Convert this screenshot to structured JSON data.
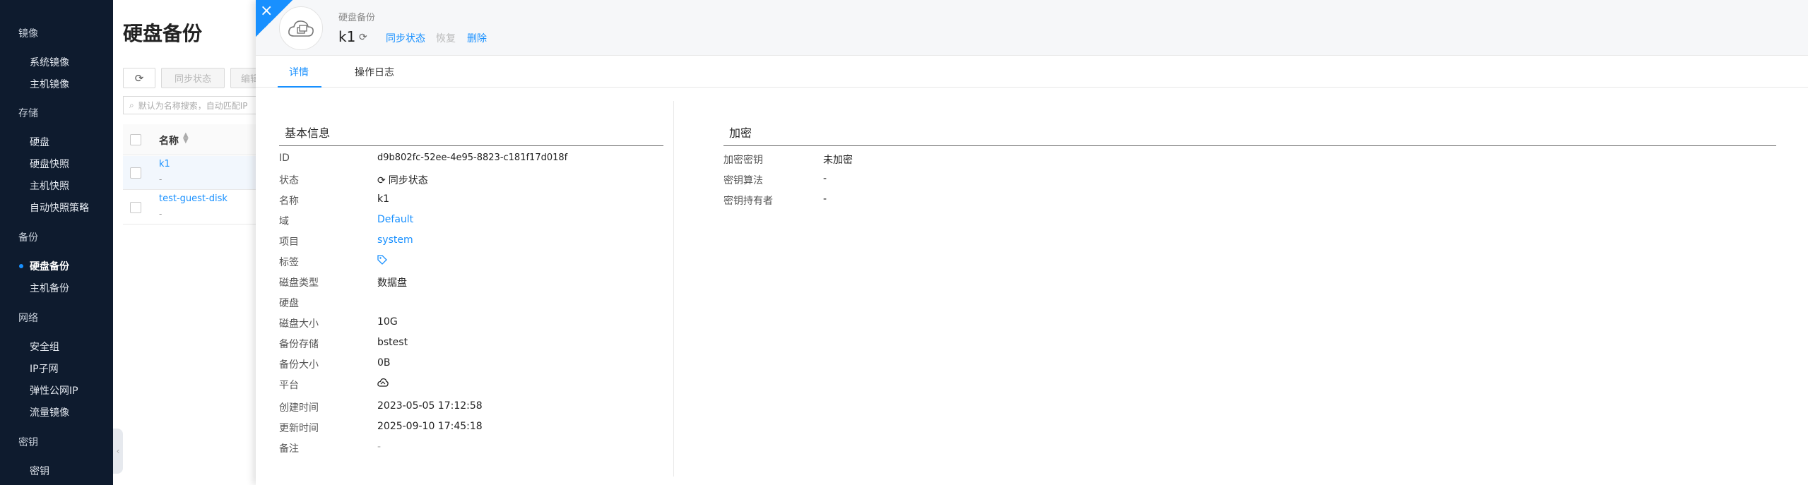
{
  "sidebar": {
    "groups": [
      {
        "label": "镜像",
        "items": [
          {
            "label": "系统镜像"
          },
          {
            "label": "主机镜像"
          }
        ]
      },
      {
        "label": "存储",
        "items": [
          {
            "label": "硬盘"
          },
          {
            "label": "硬盘快照"
          },
          {
            "label": "主机快照"
          },
          {
            "label": "自动快照策略"
          }
        ]
      },
      {
        "label": "备份",
        "items": [
          {
            "label": "硬盘备份",
            "active": true
          },
          {
            "label": "主机备份"
          }
        ]
      },
      {
        "label": "网络",
        "items": [
          {
            "label": "安全组"
          },
          {
            "label": "IP子网"
          },
          {
            "label": "弹性公网IP"
          },
          {
            "label": "流量镜像"
          }
        ]
      },
      {
        "label": "密钥",
        "items": [
          {
            "label": "密钥"
          }
        ]
      }
    ]
  },
  "list_page": {
    "title": "硬盘备份",
    "toolbar": {
      "sync_label": "同步状态",
      "edit_label": "编辑"
    },
    "search_placeholder": "默认为名称搜索，自动匹配IP",
    "columns": {
      "name": "名称"
    },
    "rows": [
      {
        "name": "k1",
        "sub": "-"
      },
      {
        "name": "test-guest-disk",
        "sub": "-"
      }
    ]
  },
  "drawer": {
    "close_label": "×",
    "resource_type": "硬盘备份",
    "resource_name": "k1",
    "actions": {
      "sync": "同步状态",
      "restore": "恢复",
      "delete": "删除"
    },
    "tabs": {
      "detail": "详情",
      "log": "操作日志"
    },
    "basic": {
      "title": "基本信息",
      "fields": {
        "id_label": "ID",
        "id": "d9b802fc-52ee-4e95-8823-c181f17d018f",
        "status_label": "状态",
        "status": "同步状态",
        "name_label": "名称",
        "name": "k1",
        "domain_label": "域",
        "domain": "Default",
        "project_label": "项目",
        "project": "system",
        "tags_label": "标签",
        "disk_type_label": "磁盘类型",
        "disk_type": "数据盘",
        "disk_label": "硬盘",
        "disk_size_label": "磁盘大小",
        "disk_size": "10G",
        "backup_storage_label": "备份存储",
        "backup_storage": "bstest",
        "backup_size_label": "备份大小",
        "backup_size": "0B",
        "platform_label": "平台",
        "created_label": "创建时间",
        "created": "2023-05-05 17:12:58",
        "updated_label": "更新时间",
        "updated": "2025-09-10 17:45:18",
        "remark_label": "备注",
        "remark": "-"
      }
    },
    "encryption": {
      "title": "加密",
      "fields": {
        "key_label": "加密密钥",
        "key": "未加密",
        "alg_label": "密钥算法",
        "alg": "-",
        "owner_label": "密钥持有者",
        "owner": "-"
      }
    }
  },
  "colors": {
    "accent": "#1890ff",
    "sidebar_bg": "#0e1b2e"
  }
}
